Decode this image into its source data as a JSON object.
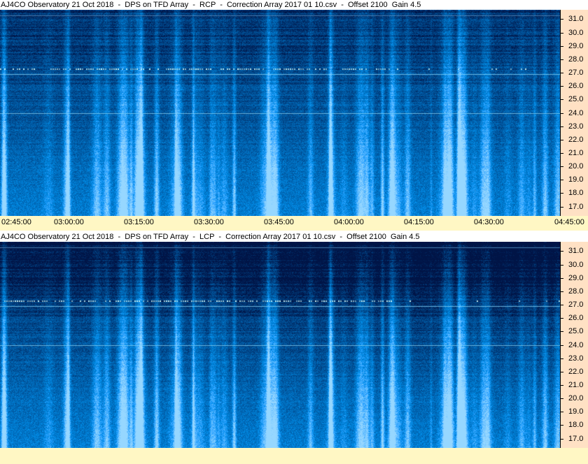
{
  "panels": [
    {
      "title": "AJ4CO Observatory 21 Oct 2018  -  DPS on TFD Array  -  RCP  -  Correction Array 2017 01 10.csv  -  Offset 2100  Gain 4.5",
      "polarization": "RCP"
    },
    {
      "title": "AJ4CO Observatory 21 Oct 2018  -  DPS on TFD Array  -  LCP  -  Correction Array 2017 01 10.csv  -  Offset 2100  Gain 4.5",
      "polarization": "LCP"
    }
  ],
  "chart_data": [
    {
      "type": "heatmap",
      "title": "AJ4CO Observatory 21 Oct 2018  -  DPS on TFD Array  -  RCP  -  Correction Array 2017 01 10.csv  -  Offset 2100  Gain 4.5",
      "xlabel": "",
      "ylabel": "",
      "x_ticks": [
        "02:45:00",
        "03:00:00",
        "03:15:00",
        "03:30:00",
        "03:45:00",
        "04:00:00",
        "04:15:00",
        "04:30:00",
        "04:45:00"
      ],
      "y_ticks": [
        "31.0",
        "30.0",
        "29.0",
        "28.0",
        "27.0",
        "26.0",
        "25.0",
        "24.0",
        "23.0",
        "22.0",
        "21.0",
        "20.0",
        "19.0",
        "18.0",
        "17.0"
      ],
      "xlim": [
        "02:45:00",
        "04:45:00"
      ],
      "ylim": [
        16.3,
        31.7
      ],
      "interference_lines_mhz": [
        27.3,
        26.9,
        24.0
      ]
    },
    {
      "type": "heatmap",
      "title": "AJ4CO Observatory 21 Oct 2018  -  DPS on TFD Array  -  LCP  -  Correction Array 2017 01 10.csv  -  Offset 2100  Gain 4.5",
      "xlabel": "",
      "ylabel": "",
      "x_ticks": [],
      "y_ticks": [
        "31.0",
        "30.0",
        "29.0",
        "28.0",
        "27.0",
        "26.0",
        "25.0",
        "24.0",
        "23.0",
        "22.0",
        "21.0",
        "20.0",
        "19.0",
        "18.0",
        "17.0"
      ],
      "xlim": [
        "02:45:00",
        "04:45:00"
      ],
      "ylim": [
        16.3,
        31.7
      ],
      "interference_lines_mhz": [
        27.3,
        26.9,
        24.0
      ]
    }
  ]
}
